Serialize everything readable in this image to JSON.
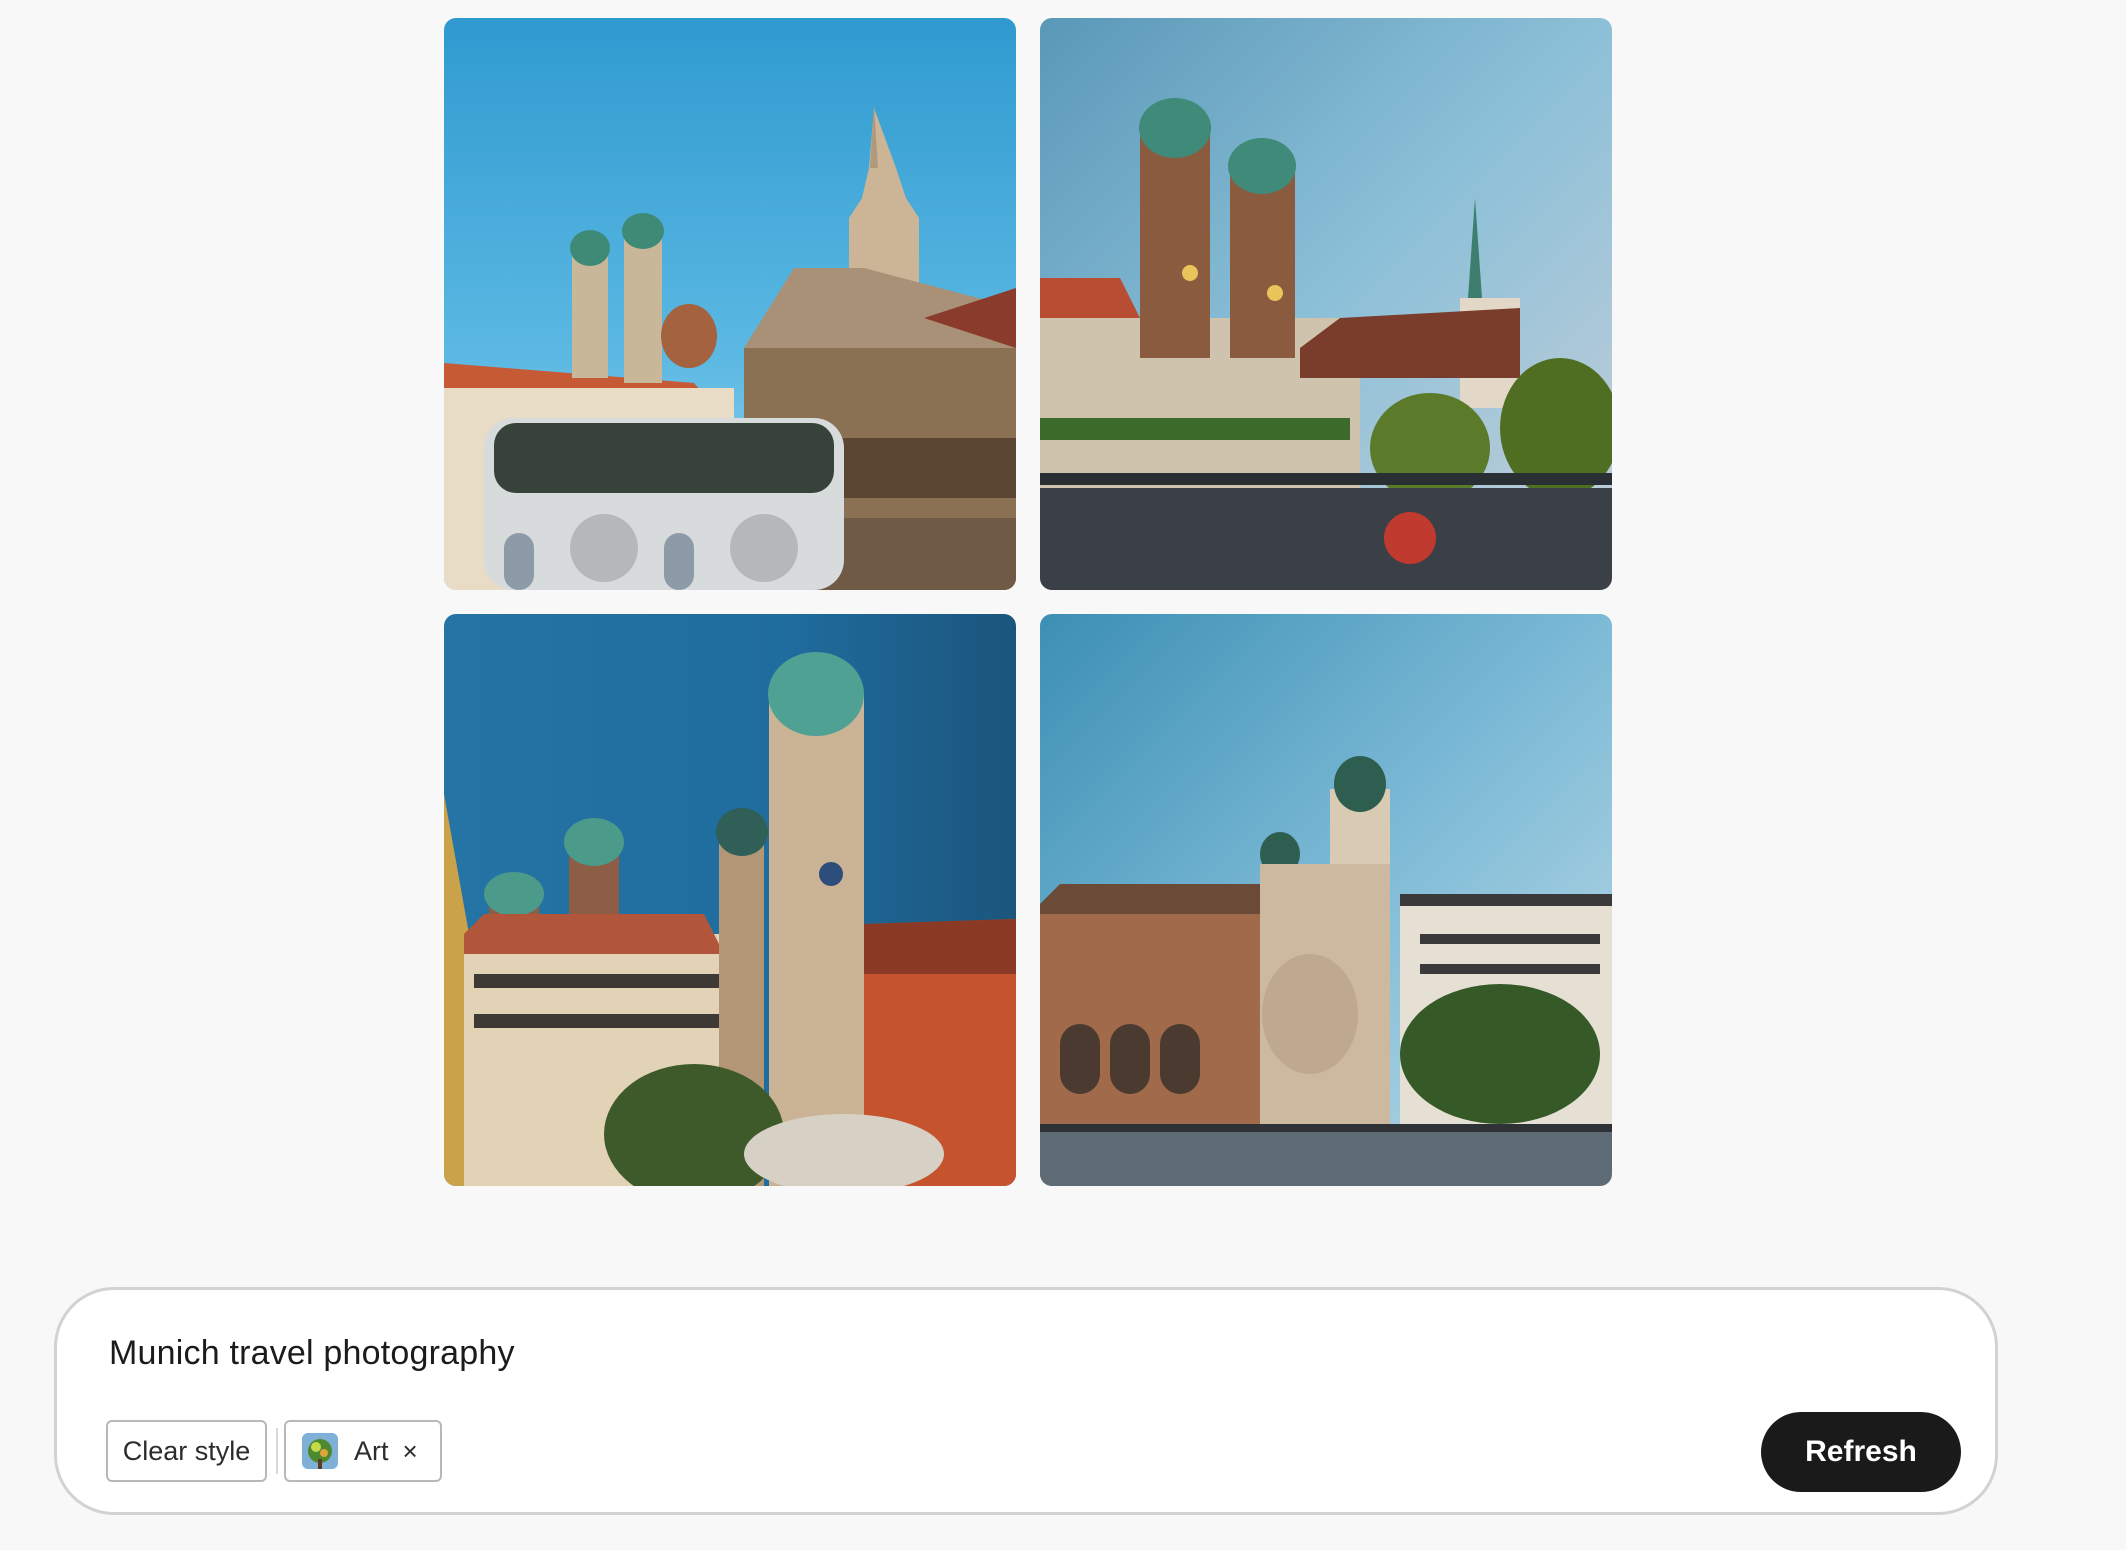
{
  "results": {
    "images": [
      {
        "alt": "Munich travel photography result 1"
      },
      {
        "alt": "Munich travel photography result 2"
      },
      {
        "alt": "Munich travel photography result 3"
      },
      {
        "alt": "Munich travel photography result 4"
      }
    ]
  },
  "prompt": {
    "text": "Munich travel photography",
    "clear_style_label": "Clear style",
    "style_chip": {
      "label": "Art",
      "remove_icon": "×"
    },
    "refresh_label": "Refresh"
  },
  "colors": {
    "background": "#f8f8f8",
    "panel": "#ffffff",
    "button": "#1a1a1a",
    "button_text": "#ffffff"
  }
}
